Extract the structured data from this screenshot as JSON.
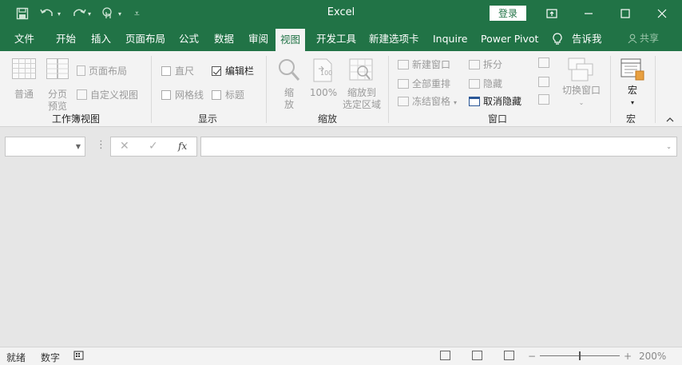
{
  "titlebar": {
    "title": "Excel",
    "login_label": "登录",
    "save_icon": "save-icon",
    "undo_icon": "undo-icon",
    "redo_icon": "redo-icon",
    "touch_mode_icon": "touch-mode-icon",
    "customize_icon": "customize-quick-access-icon"
  },
  "tabs": [
    {
      "label": "文件"
    },
    {
      "label": "开始"
    },
    {
      "label": "插入"
    },
    {
      "label": "页面布局"
    },
    {
      "label": "公式"
    },
    {
      "label": "数据"
    },
    {
      "label": "审阅"
    },
    {
      "label": "视图"
    },
    {
      "label": "开发工具"
    },
    {
      "label": "新建选项卡"
    },
    {
      "label": "Inquire"
    },
    {
      "label": "Power Pivot"
    },
    {
      "label": "告诉我"
    }
  ],
  "active_tab": "视图",
  "share_label": "共享",
  "ribbon": {
    "workbook_views": {
      "label": "工作簿视图",
      "normal": "普通",
      "page_break_1": "分页",
      "page_break_2": "预览",
      "page_layout": "页面布局",
      "custom_views": "自定义视图"
    },
    "show": {
      "label": "显示",
      "ruler": "直尺",
      "formula_bar": "编辑栏",
      "gridlines": "网格线",
      "headings": "标题",
      "ruler_checked": false,
      "formula_bar_checked": true,
      "gridlines_checked": false,
      "headings_checked": false
    },
    "zoom": {
      "label": "缩放",
      "zoom_1": "缩",
      "zoom_2": "放",
      "zoom_100": "100%",
      "zoom_sel_1": "缩放到",
      "zoom_sel_2": "选定区域"
    },
    "window": {
      "label": "窗口",
      "new_window": "新建窗口",
      "arrange_all": "全部重排",
      "freeze_panes": "冻结窗格",
      "split": "拆分",
      "hide": "隐藏",
      "unhide": "取消隐藏",
      "switch_windows": "切换窗口"
    },
    "macros": {
      "label": "宏",
      "macros_button": "宏"
    }
  },
  "formula_bar": {
    "name_box_value": "",
    "formula_value": "",
    "cancel_icon": "cancel-icon",
    "enter_icon": "enter-icon",
    "fx_label": "fx"
  },
  "statusbar": {
    "ready": "就绪",
    "num_lock": "数字",
    "zoom_label": "200%",
    "zoom_minus": "−",
    "zoom_plus": "+",
    "zoom_level": 200
  },
  "colors": {
    "accent": "#217346",
    "ribbon_bg": "#f3f3f3",
    "canvas_bg": "#e6e6e6"
  }
}
